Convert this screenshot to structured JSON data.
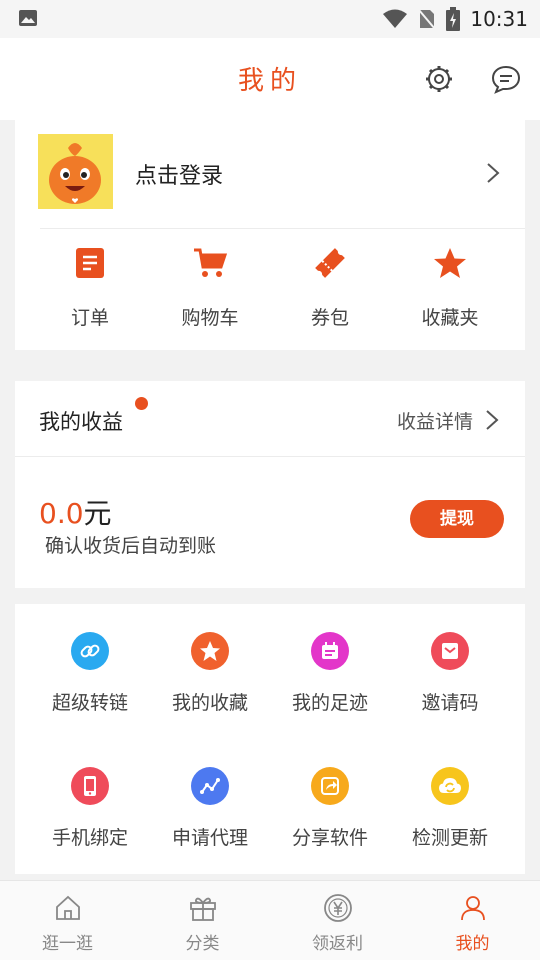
{
  "status_bar": {
    "time": "10:31"
  },
  "header": {
    "title": "我的"
  },
  "profile": {
    "login_label": "点击登录"
  },
  "quick_links": [
    {
      "icon": "order-list-icon",
      "label": "订单"
    },
    {
      "icon": "shopping-cart-icon",
      "label": "购物车"
    },
    {
      "icon": "coupon-icon",
      "label": "券包"
    },
    {
      "icon": "star-icon",
      "label": "收藏夹"
    }
  ],
  "earnings": {
    "title": "我的收益",
    "detail_label": "收益详情",
    "amount": "0.0",
    "unit": "元",
    "note": "确认收货后自动到账",
    "withdraw_label": "提现"
  },
  "tools": [
    {
      "icon": "link-icon",
      "label": "超级转链",
      "color": "#29a9f0"
    },
    {
      "icon": "star-icon",
      "label": "我的收藏",
      "color": "#f0612d"
    },
    {
      "icon": "calendar-icon",
      "label": "我的足迹",
      "color": "#e336c9"
    },
    {
      "icon": "envelope-icon",
      "label": "邀请码",
      "color": "#ef4b5a"
    },
    {
      "icon": "phone-icon",
      "label": "手机绑定",
      "color": "#ef4b5a"
    },
    {
      "icon": "chart-line-icon",
      "label": "申请代理",
      "color": "#4d79f0"
    },
    {
      "icon": "share-icon",
      "label": "分享软件",
      "color": "#f7a91c"
    },
    {
      "icon": "cloud-refresh-icon",
      "label": "检测更新",
      "color": "#f7c51c"
    }
  ],
  "tabbar": [
    {
      "icon": "home-icon",
      "label": "逛一逛",
      "active": false
    },
    {
      "icon": "gift-icon",
      "label": "分类",
      "active": false
    },
    {
      "icon": "yuan-coin-icon",
      "label": "领返利",
      "active": false
    },
    {
      "icon": "user-icon",
      "label": "我的",
      "active": true
    }
  ],
  "colors": {
    "accent": "#e8501f",
    "background": "#f2f2f2"
  }
}
